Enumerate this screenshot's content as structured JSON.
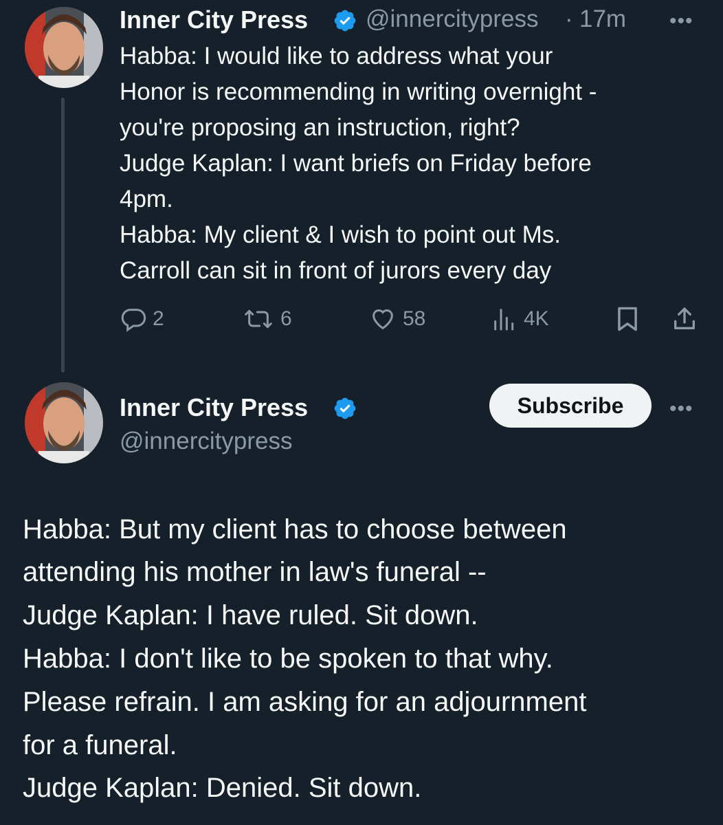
{
  "colors": {
    "background": "#15202b",
    "text": "#f7f9f9",
    "muted": "#8b98a5",
    "verified": "#1d9bf0",
    "thread_line": "#38444d"
  },
  "tweet1": {
    "author_name": "Inner City Press",
    "handle": "@innercitypress",
    "separator": "·",
    "time": "17m",
    "more_label": "•••",
    "avatar_icon": "user-avatar",
    "lines": [
      "Habba: I would like to address what your",
      "Honor is recommending in writing overnight -",
      "you're proposing an instruction, right?",
      "Judge Kaplan: I want briefs on Friday before",
      "4pm.",
      "Habba: My client & I wish to point out Ms.",
      "Carroll can sit in front of jurors every day"
    ],
    "actions": {
      "replies": "2",
      "retweets": "6",
      "likes": "58",
      "views": "4K"
    }
  },
  "tweet2": {
    "author_name": "Inner City Press",
    "handle": "@innercitypress",
    "subscribe_label": "Subscribe",
    "more_label": "•••",
    "lines": [
      "Habba: But my client has to choose between",
      "attending his mother in law's funeral --",
      "Judge Kaplan: I have ruled. Sit down.",
      "Habba: I don't like to be spoken to that why.",
      "Please refrain. I am asking for an adjournment",
      "for a funeral.",
      "Judge Kaplan: Denied. Sit down."
    ]
  }
}
